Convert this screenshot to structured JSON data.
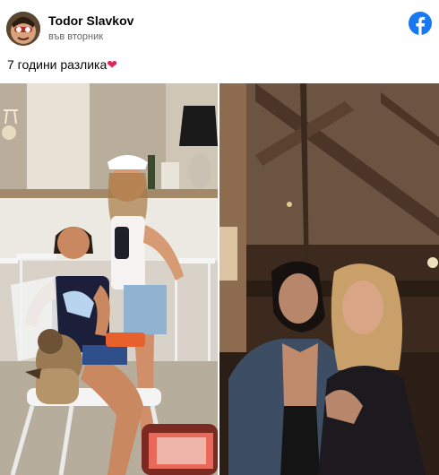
{
  "author": {
    "name": "Todor Slavkov",
    "time": "във вторник"
  },
  "icons": {
    "platform_logo": "facebook-logo-icon"
  },
  "post": {
    "text": "7 години разлика",
    "emoji": "❤"
  },
  "colors": {
    "facebook_blue": "#1877f2",
    "heart": "#e0245e",
    "name_text": "#050505",
    "meta_text": "#65676b"
  }
}
